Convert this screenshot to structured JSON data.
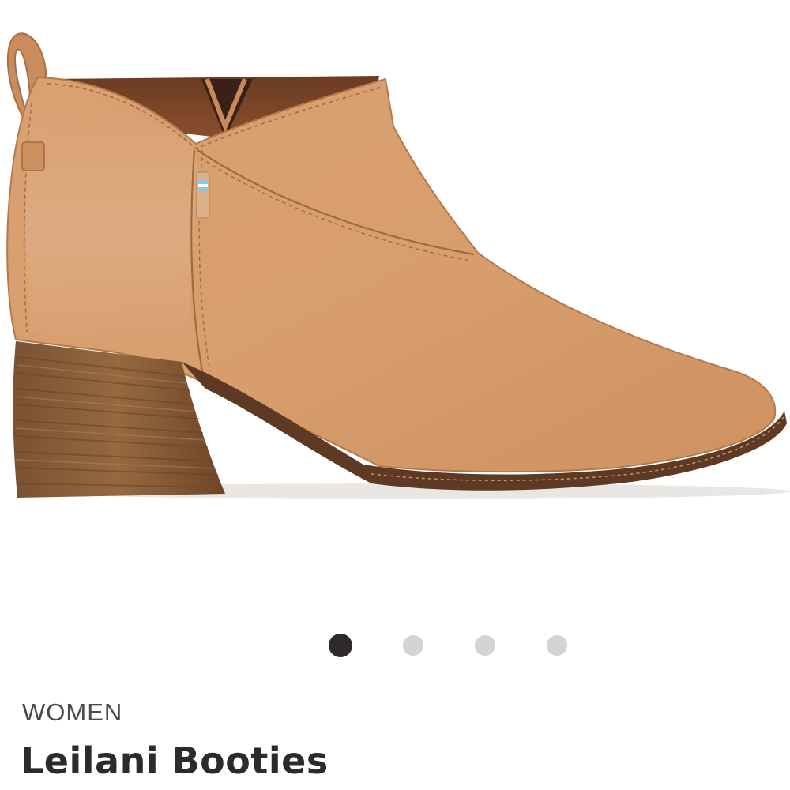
{
  "product": {
    "image_alt": "",
    "category": "WOMEN",
    "title": "Leilani Booties"
  },
  "carousel": {
    "total": 4,
    "active_index": 0
  },
  "colors": {
    "leather": "#d59a6a",
    "heel": "#8b6240",
    "sole": "#5e3a24",
    "dot_active": "#2e2a29",
    "dot_inactive": "#d4d4d4",
    "title": "#2b2b2b",
    "category": "#4a4a4a"
  }
}
